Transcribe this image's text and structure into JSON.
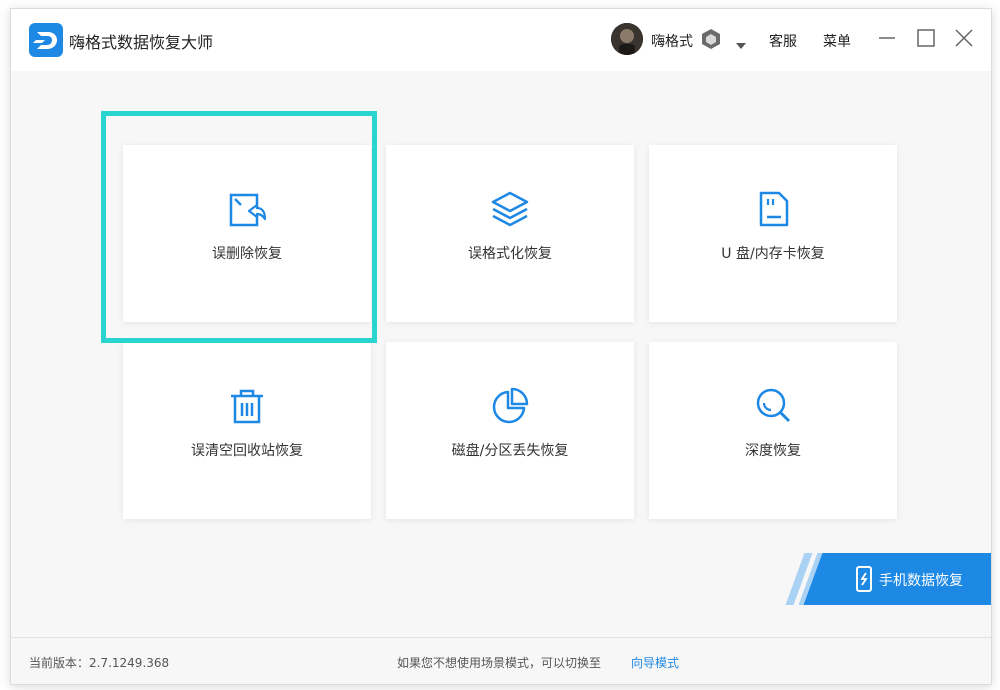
{
  "app": {
    "title": "嗨格式数据恢复大师"
  },
  "user": {
    "name": "嗨格式"
  },
  "header": {
    "service": "客服",
    "menu": "菜单"
  },
  "cards": [
    {
      "label": "误删除恢复",
      "icon": "file-restore-icon"
    },
    {
      "label": "误格式化恢复",
      "icon": "layers-icon"
    },
    {
      "label": "U 盘/内存卡恢复",
      "icon": "sd-card-icon"
    },
    {
      "label": "误清空回收站恢复",
      "icon": "trash-icon"
    },
    {
      "label": "磁盘/分区丢失恢复",
      "icon": "pie-chart-icon"
    },
    {
      "label": "深度恢复",
      "icon": "magnifier-icon"
    }
  ],
  "mobile_recovery": {
    "label": "手机数据恢复"
  },
  "footer": {
    "version": "当前版本：2.7.1249.368",
    "hint": "如果您不想使用场景模式，可以切换至",
    "guide_link": "向导模式"
  },
  "colors": {
    "accent": "#1e88e5",
    "highlight": "#2ad5cf",
    "background": "#f7f7f7"
  }
}
